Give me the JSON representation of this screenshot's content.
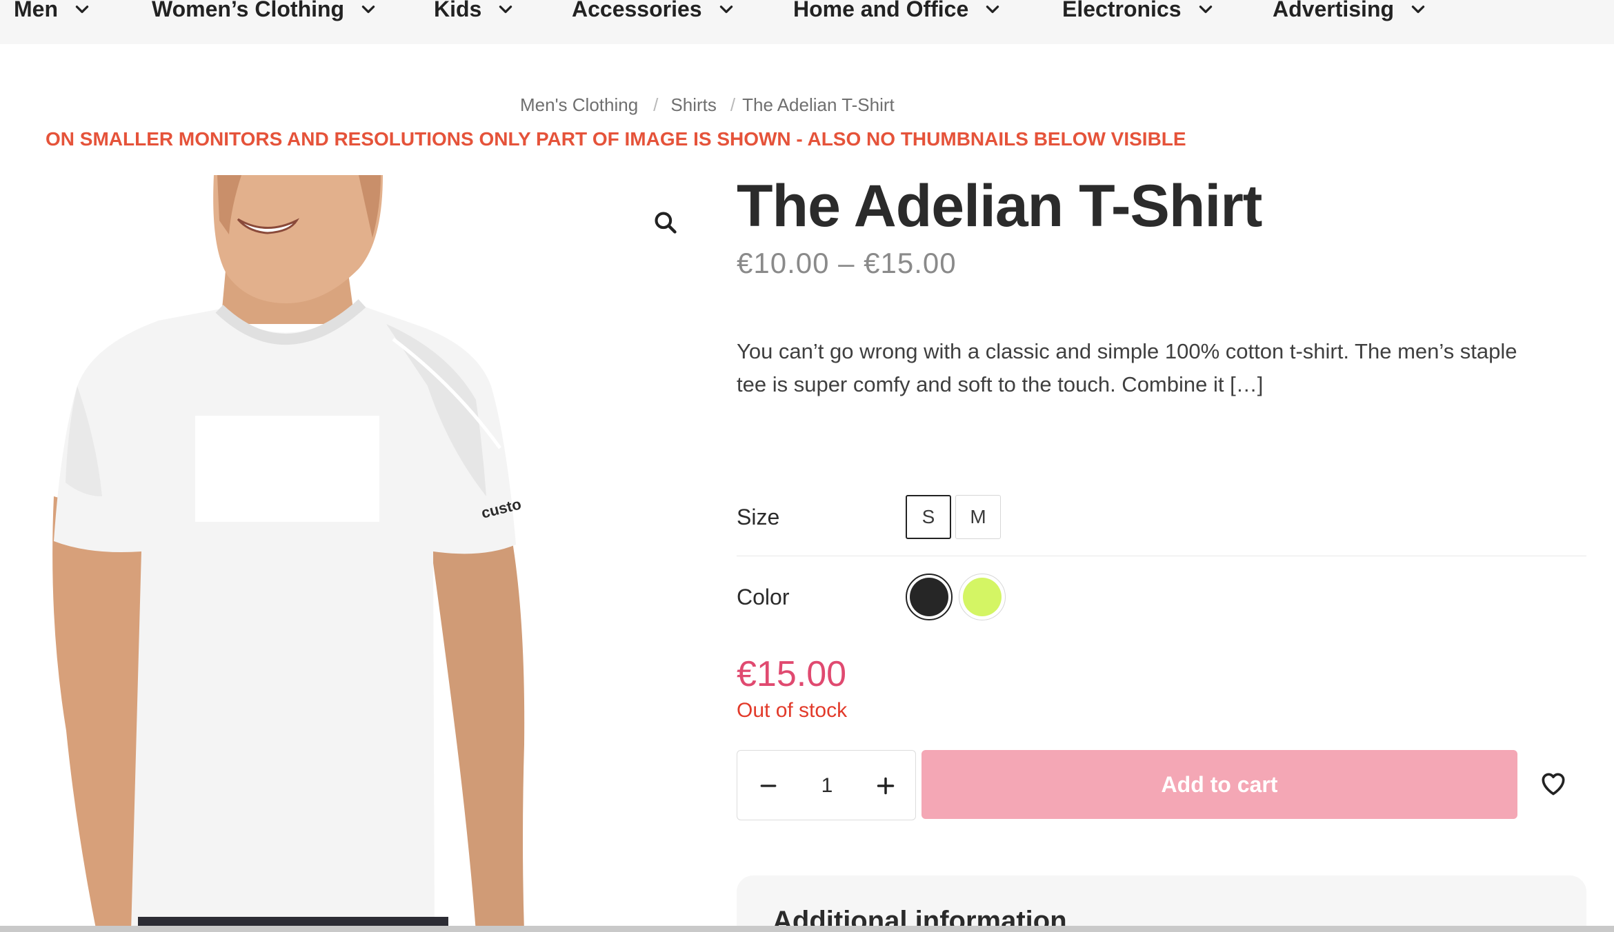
{
  "nav": {
    "items": [
      {
        "label": "Men"
      },
      {
        "label": "Women’s Clothing"
      },
      {
        "label": "Kids"
      },
      {
        "label": "Accessories"
      },
      {
        "label": "Home and Office"
      },
      {
        "label": "Electronics"
      },
      {
        "label": "Advertising"
      }
    ],
    "chevron_icon": "chevron-down-icon"
  },
  "breadcrumb": {
    "items": [
      "Men's Clothing",
      "Shirts",
      "The Adelian T-Shirt"
    ],
    "separator": "/"
  },
  "warning": {
    "text": "ON SMALLER MONITORS AND RESOLUTIONS ONLY PART OF IMAGE IS SHOWN - ALSO NO THUMBNAILS BELOW VISIBLE",
    "color": "#e5533a"
  },
  "gallery": {
    "zoom_icon": "search-icon",
    "sleeve_text": "custo"
  },
  "product": {
    "title": "The Adelian T-Shirt",
    "price_range": "€10.00 – €15.00",
    "description": "You can’t go wrong with a classic and simple 100% cotton t-shirt. The men’s staple tee is super comfy and soft to the touch. Combine it […]",
    "attributes": {
      "size_label": "Size",
      "size_options": [
        "S",
        "M"
      ],
      "size_selected": "S",
      "color_label": "Color",
      "color_options": [
        {
          "name": "black",
          "hex": "#262626",
          "selected": true
        },
        {
          "name": "lime",
          "hex": "#d4f564",
          "selected": false
        }
      ]
    },
    "price": "€15.00",
    "stock_status": "Out of stock",
    "quantity": "1",
    "add_to_cart_label": "Add to cart",
    "wishlist_icon": "heart-icon",
    "colors": {
      "price": "#e04a70",
      "stock": "#e23a2a",
      "cart_button": "#f4a7b5"
    }
  },
  "tabs": {
    "additional_info_title": "Additional information"
  }
}
